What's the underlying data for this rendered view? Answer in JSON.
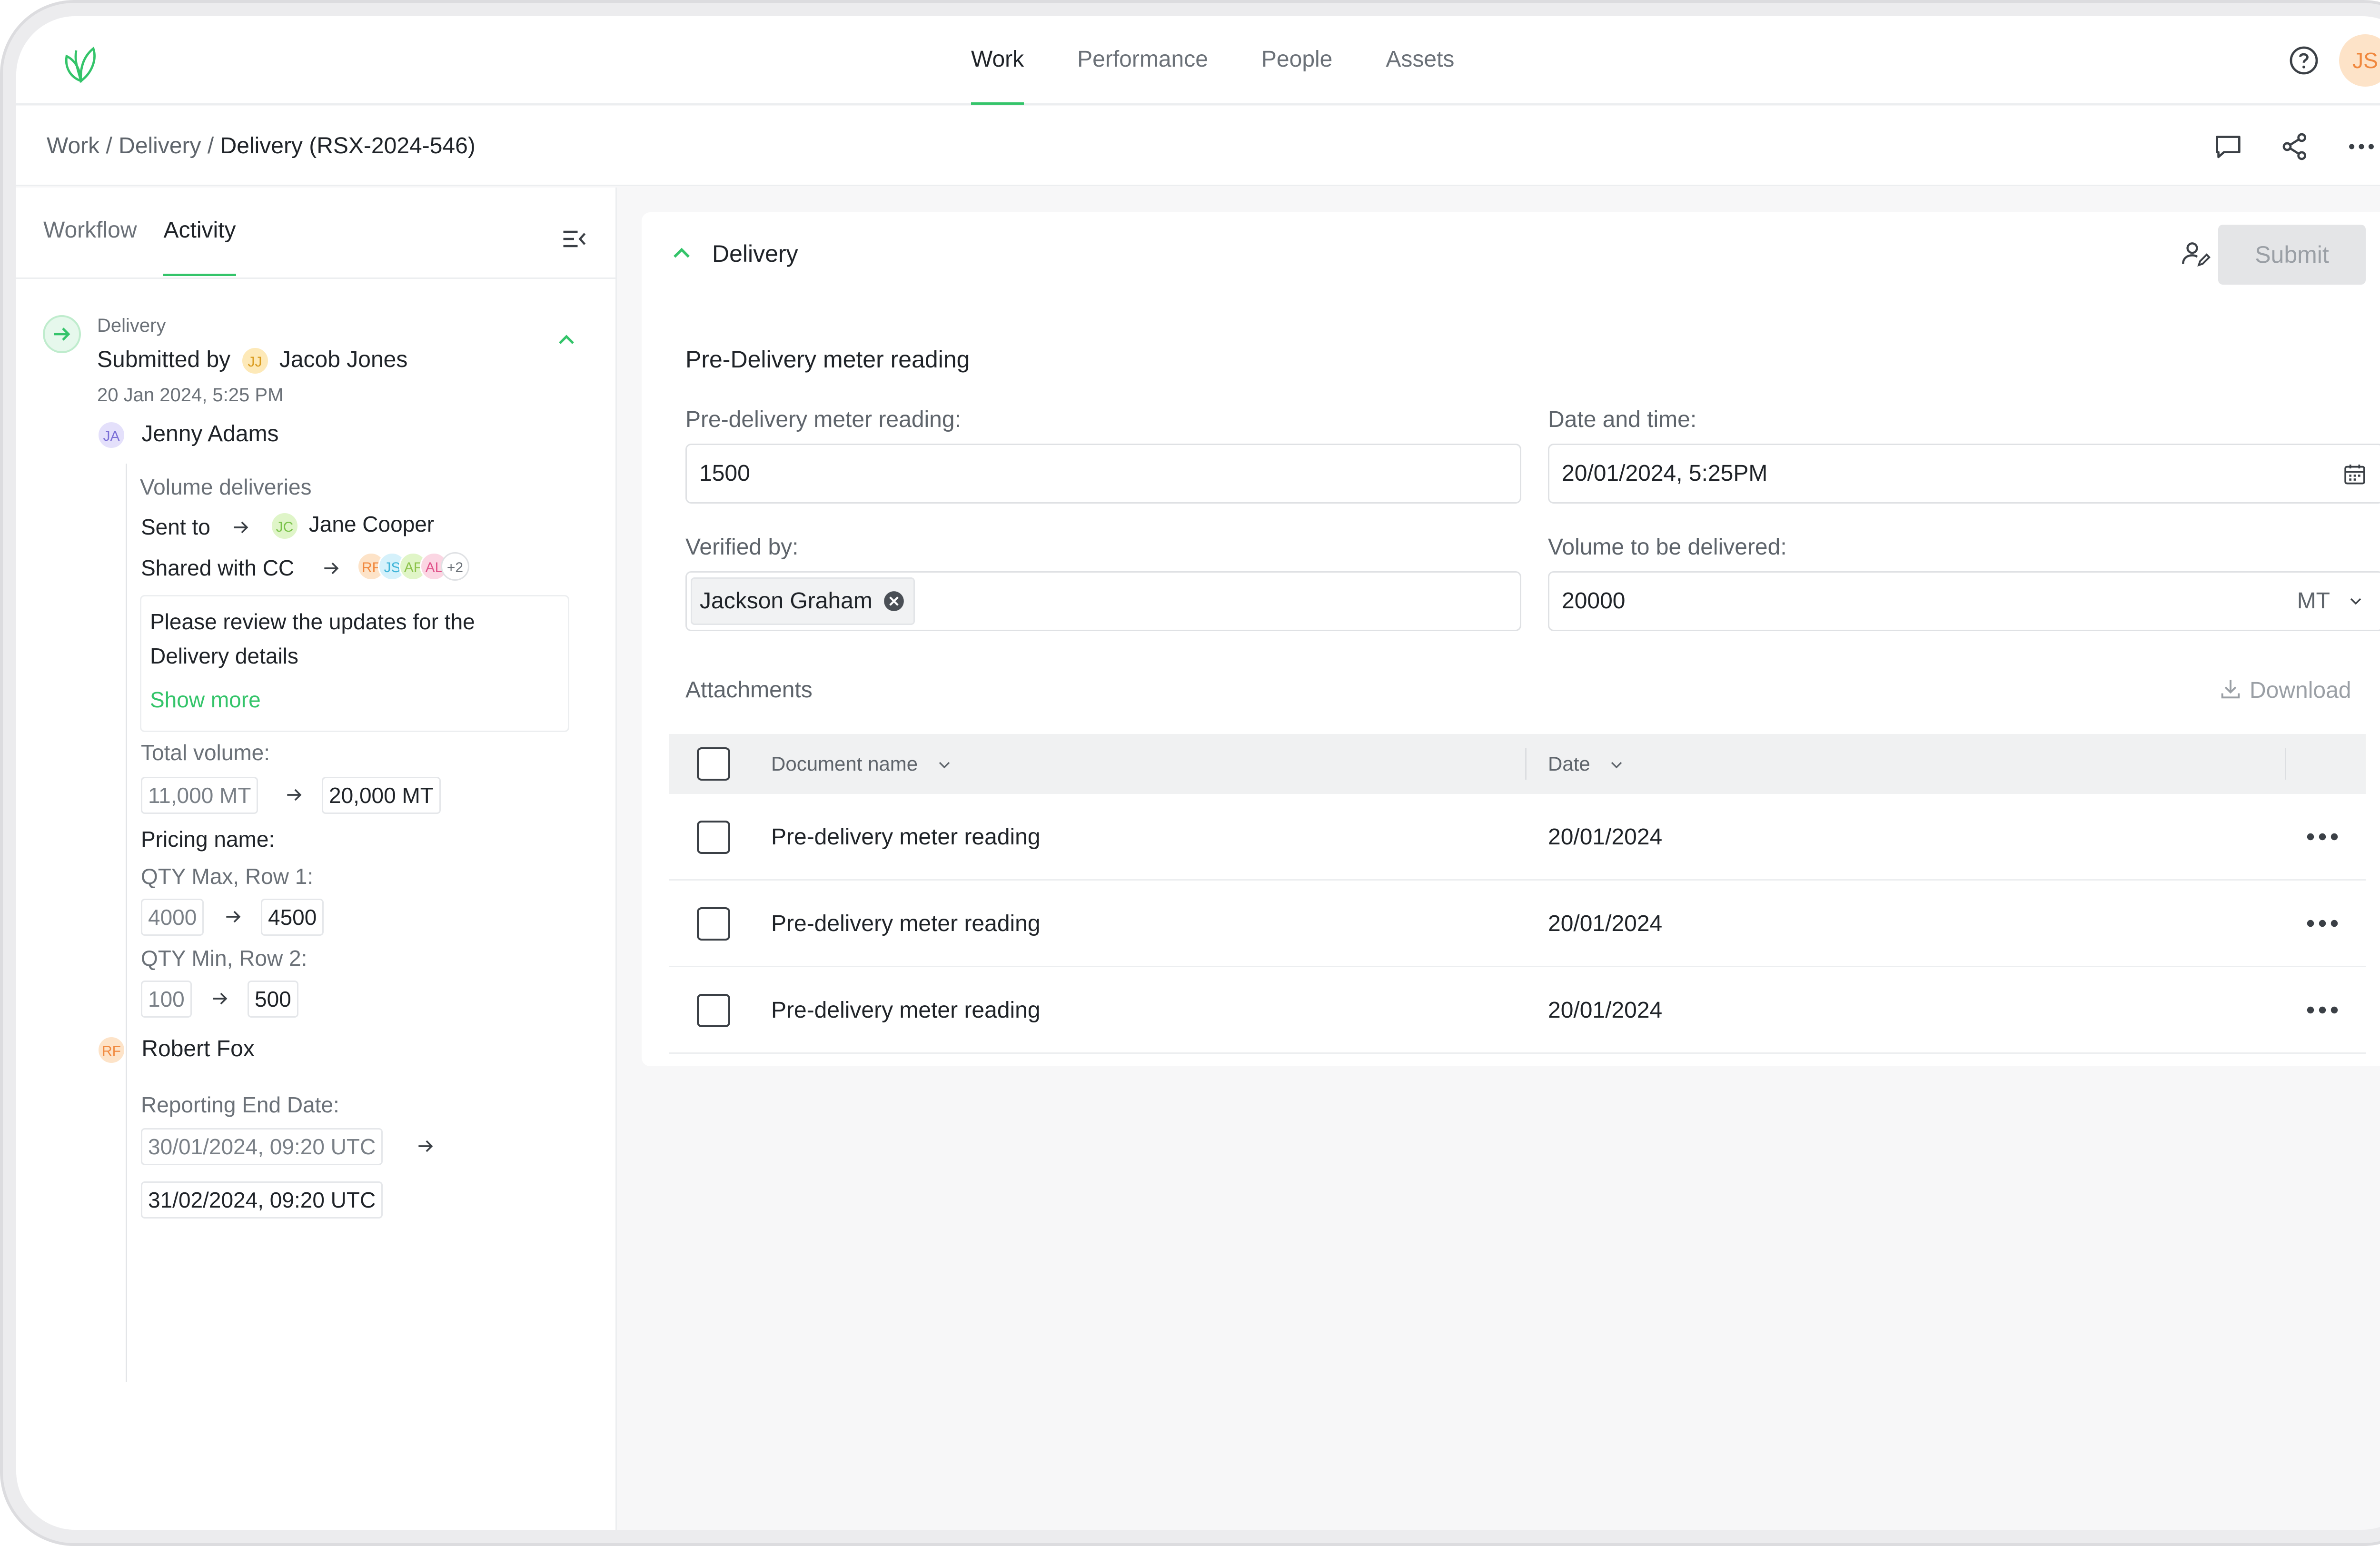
{
  "nav": {
    "tabs": [
      {
        "label": "Work",
        "active": true
      },
      {
        "label": "Performance",
        "active": false
      },
      {
        "label": "People",
        "active": false
      },
      {
        "label": "Assets",
        "active": false
      }
    ],
    "user_initials": "JS",
    "accent_color": "#34c46a"
  },
  "breadcrumb": {
    "items": [
      "Work",
      "Delivery"
    ],
    "separator": "/",
    "current": "Delivery (RSX-2024-546)"
  },
  "left_panel": {
    "tabs": [
      {
        "label": "Workflow",
        "active": false
      },
      {
        "label": "Activity",
        "active": true
      }
    ],
    "activity": {
      "stage": "Delivery",
      "submitted_by_label": "Submitted by",
      "submitter_initials": "JJ",
      "submitter_name": "Jacob Jones",
      "timestamp": "20 Jan 2024, 5:25 PM",
      "entries": [
        {
          "initials": "JA",
          "name": "Jenny Adams",
          "section": "Volume deliveries",
          "sent_to_label": "Sent to",
          "sent_to_initials": "JC",
          "sent_to_name": "Jane Cooper",
          "shared_cc_label": "Shared with CC",
          "cc_avatars": [
            "RF",
            "JS",
            "AF",
            "AL"
          ],
          "cc_more": "+2",
          "message": "Please review the updates for the Delivery details",
          "message_line1": "Please review the updates for the",
          "message_line2": "Delivery details",
          "show_more": "Show more",
          "total_volume_label": "Total volume:",
          "total_volume_old": "11,000 MT",
          "total_volume_new": "20,000 MT",
          "pricing_label": "Pricing name:",
          "qty_max_label": "QTY Max, Row 1:",
          "qty_max_old": "4000",
          "qty_max_new": "4500",
          "qty_min_label": "QTY Min, Row 2:",
          "qty_min_old": "100",
          "qty_min_new": "500"
        },
        {
          "initials": "RF",
          "name": "Robert Fox",
          "reporting_label": "Reporting End Date:",
          "reporting_old": "30/01/2024, 09:20 UTC",
          "reporting_new": "31/02/2024, 09:20 UTC"
        }
      ]
    }
  },
  "card": {
    "title": "Delivery",
    "submit_label": "Submit",
    "section_title": "Pre-Delivery meter reading",
    "fields": {
      "meter_label": "Pre-delivery meter reading:",
      "meter_value": "1500",
      "datetime_label": "Date and time:",
      "datetime_value": "20/01/2024, 5:25PM",
      "verified_label": "Verified by:",
      "verified_tag": "Jackson Graham",
      "volume_label": "Volume to be delivered:",
      "volume_value": "20000",
      "volume_unit": "MT"
    },
    "attachments": {
      "label": "Attachments",
      "download_label": "Download",
      "columns": [
        "Document name",
        "Date"
      ],
      "rows": [
        {
          "name": "Pre-delivery meter reading",
          "date": "20/01/2024"
        },
        {
          "name": "Pre-delivery meter reading",
          "date": "20/01/2024"
        },
        {
          "name": "Pre-delivery meter reading",
          "date": "20/01/2024"
        }
      ]
    }
  }
}
